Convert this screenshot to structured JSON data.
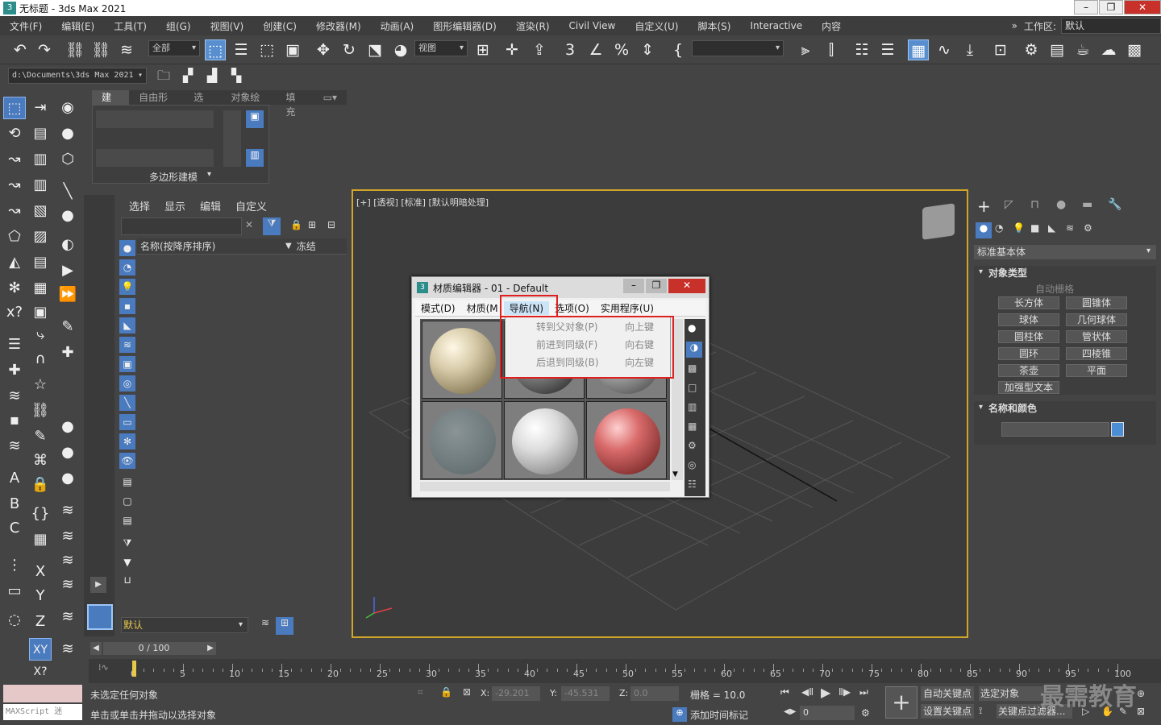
{
  "title": "无标题 - 3ds Max 2021",
  "menus": [
    "文件(F)",
    "编辑(E)",
    "工具(T)",
    "组(G)",
    "视图(V)",
    "创建(C)",
    "修改器(M)",
    "动画(A)",
    "图形编辑器(D)",
    "渲染(R)",
    "Civil View",
    "自定义(U)",
    "脚本(S)",
    "Interactive",
    "内容"
  ],
  "workspace": {
    "label": "工作区:",
    "value": "默认",
    "chevron": "»"
  },
  "toolbar": {
    "filter": "全部",
    "ref_coord": "视图"
  },
  "path": "d:\\Documents\\3ds Max 2021",
  "ribbon": {
    "tabs": [
      "建模",
      "自由形式",
      "选择",
      "对象绘制",
      "填充"
    ],
    "group": "多边形建模"
  },
  "scene_explorer": {
    "tabs": [
      "选择",
      "显示",
      "编辑",
      "自定义"
    ],
    "col_name": "名称(按降序排序)",
    "col_freeze": "冻结",
    "layer": "默认"
  },
  "viewport": {
    "label": "[+] [透视] [标准] [默认明暗处理]"
  },
  "command_panel": {
    "category": "标准基本体",
    "object_type": "对象类型",
    "autogrid": "自动栅格",
    "objects": [
      "长方体",
      "圆锥体",
      "球体",
      "几何球体",
      "圆柱体",
      "管状体",
      "圆环",
      "四棱锥",
      "茶壶",
      "平面",
      "加强型文本"
    ],
    "name_color": "名称和颜色",
    "color": "#4a8fd6"
  },
  "material_editor": {
    "title": "材质编辑器 - 01 - Default",
    "menu": [
      "模式(D)",
      "材质(M",
      "导航(N)",
      "选项(O)",
      "实用程序(U)"
    ],
    "nav_items": [
      {
        "label": "转到父对象(P)",
        "key": "向上键"
      },
      {
        "label": "前进到同级(F)",
        "key": "向右键"
      },
      {
        "label": "后退到同级(B)",
        "key": "向左键"
      }
    ]
  },
  "timeline": {
    "frame": "0 / 100",
    "ticks": [
      "0",
      "5",
      "10",
      "15",
      "20",
      "25",
      "30",
      "35",
      "40",
      "45",
      "50",
      "55",
      "60",
      "65",
      "70",
      "75",
      "80",
      "85",
      "90",
      "95",
      "100"
    ]
  },
  "status": {
    "line1": "未选定任何对象",
    "line2": "单击或单击并拖动以选择对象",
    "x_label": "X:",
    "x": "-29.201",
    "y_label": "Y:",
    "y": "-45.531",
    "z_label": "Z:",
    "z": "0.0",
    "grid": "栅格 = 10.0",
    "add_time_tag": "添加时间标记",
    "auto_key": "自动关键点",
    "set_key": "设置关键点",
    "selected": "选定对象",
    "key_filter": "关键点过滤器...",
    "frame_input": "0",
    "maxscript": "MAXScript 迷",
    "watermark": "最需教育"
  }
}
